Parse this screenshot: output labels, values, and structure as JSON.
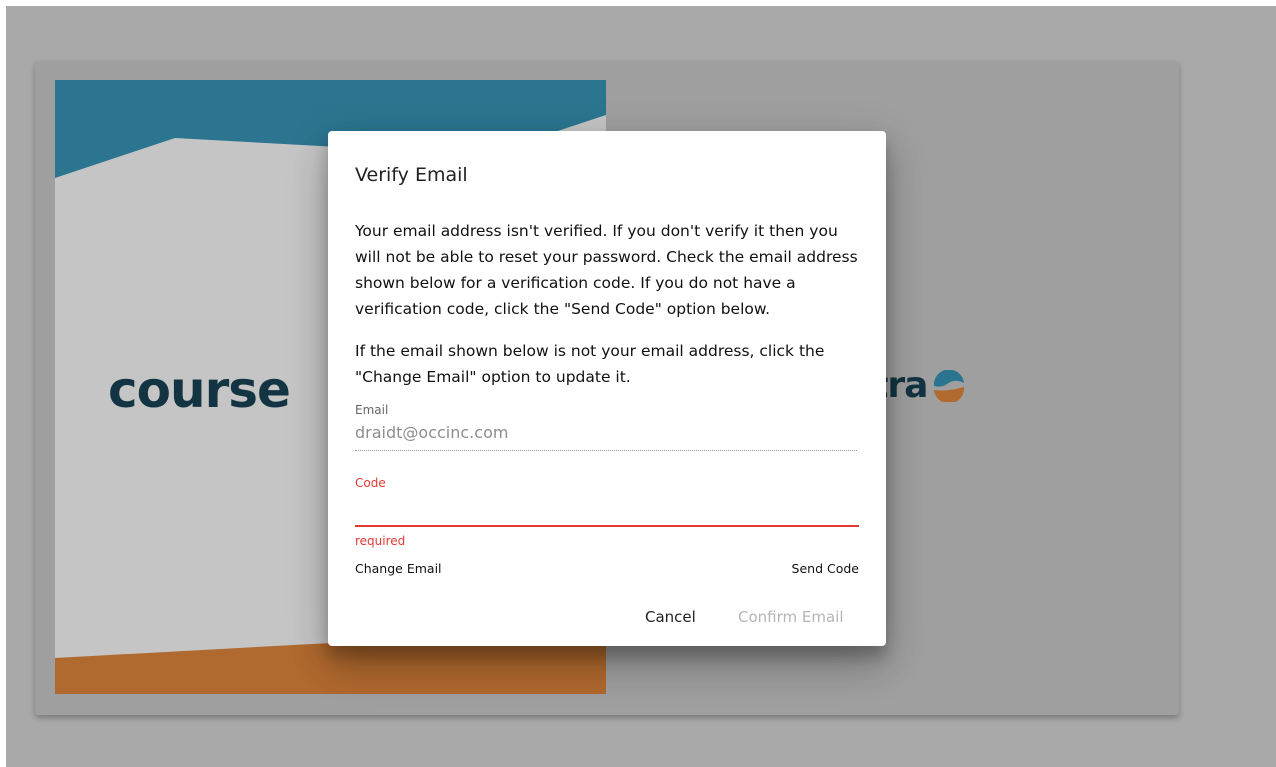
{
  "background": {
    "logo_left_text": "course",
    "logo_right_text": "ttra",
    "colors": {
      "overlay": "#a9a9a9",
      "cover_blue": "#2b7590",
      "cover_orange": "#b0692e",
      "logo_dark": "#123443"
    }
  },
  "dialog": {
    "title": "Verify Email",
    "paragraph_1": "Your email address isn't verified. If you don't verify it then you will not be able to reset your password. Check the email address shown below for a verification code. If you do not have a verification code, click the \"Send Code\" option below.",
    "paragraph_2": "If the email shown below is not your email address, click the \"Change Email\" option to update it.",
    "email": {
      "label": "Email",
      "value": "draidt@occinc.com"
    },
    "code": {
      "label": "Code",
      "value": "",
      "error": "required",
      "error_color": "#e53935"
    },
    "links": {
      "change_email": "Change Email",
      "send_code": "Send Code"
    },
    "buttons": {
      "cancel": "Cancel",
      "confirm": "Confirm Email"
    }
  }
}
